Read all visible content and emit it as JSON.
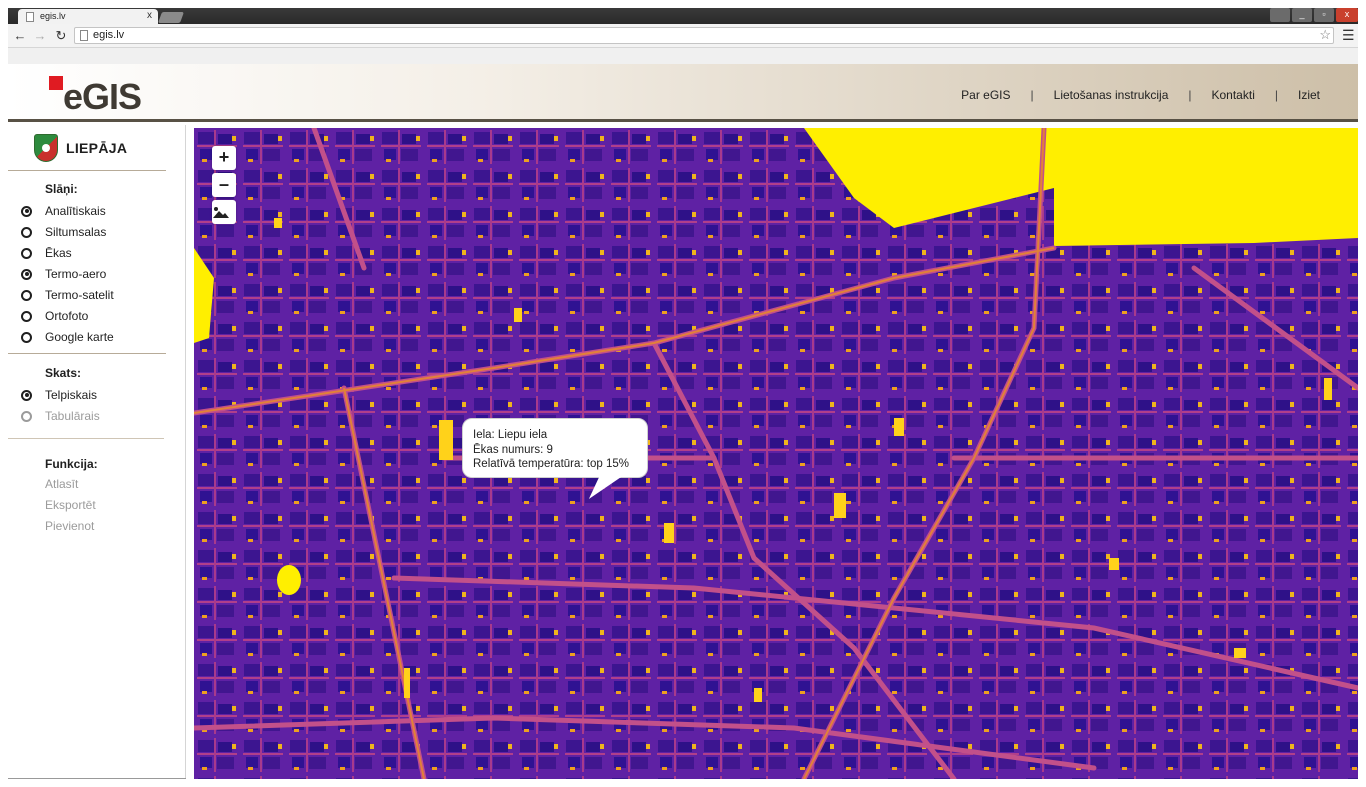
{
  "browser": {
    "tab_title": "egis.lv",
    "url": "egis.lv",
    "close_glyph": "x",
    "window_controls": [
      "_",
      "▫",
      "x"
    ]
  },
  "header": {
    "logo": "eGIS",
    "nav": [
      "Par eGIS",
      "Lietošanas instrukcija",
      "Kontakti",
      "Iziet"
    ]
  },
  "sidebar": {
    "city": "LIEPĀJA",
    "layers_title": "Slāņi:",
    "layers": [
      {
        "label": "Analītiskais",
        "selected": true
      },
      {
        "label": "Siltumsalas",
        "selected": false
      },
      {
        "label": "Ēkas",
        "selected": false
      },
      {
        "label": "Termo-aero",
        "selected": true
      },
      {
        "label": "Termo-satelit",
        "selected": false
      },
      {
        "label": "Ortofoto",
        "selected": false
      },
      {
        "label": "Google karte",
        "selected": false
      }
    ],
    "view_title": "Skats:",
    "views": [
      {
        "label": "Telpiskais",
        "selected": true
      },
      {
        "label": "Tabulārais",
        "selected": false
      }
    ],
    "func_title": "Funkcija:",
    "functions": [
      "Atlasīt",
      "Eksportēt",
      "Pievienot"
    ]
  },
  "map": {
    "zoom_in": "+",
    "zoom_out": "–",
    "colors": {
      "cold": "#3a0f8f",
      "mid": "#7a1fa8",
      "warm": "#e6761a",
      "hot": "#fff200"
    },
    "popup": {
      "line1": "Iela: Liepu iela",
      "line2": "Ēkas numurs: 9",
      "line3": "Relatīvā temperatūra: top 15%"
    }
  }
}
